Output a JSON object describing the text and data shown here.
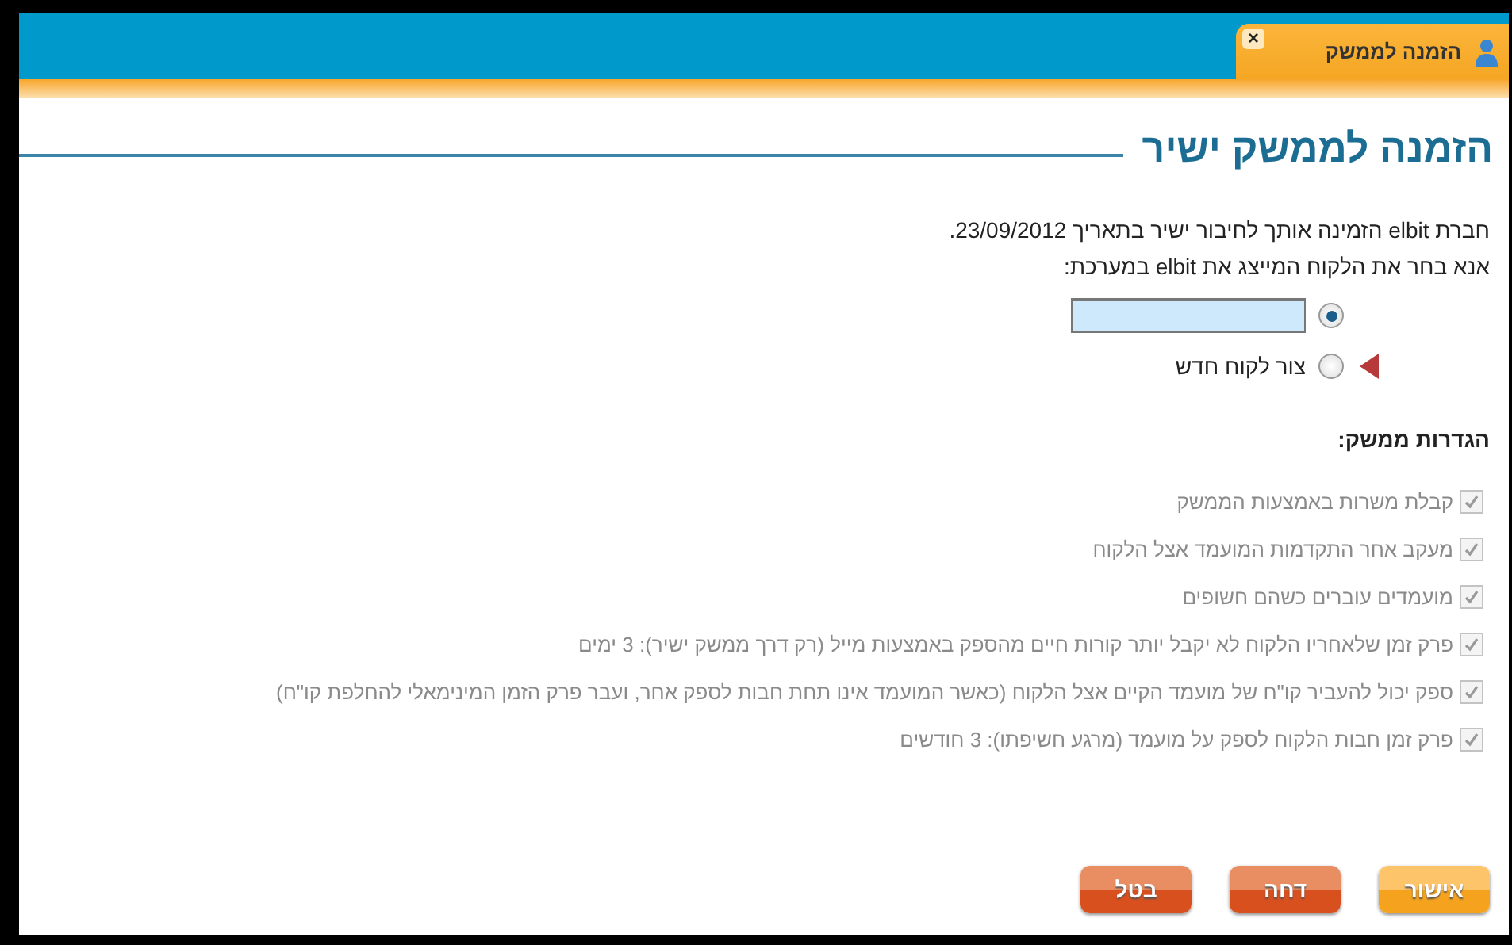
{
  "tab": {
    "title": "הזמנה לממשק",
    "close": "×"
  },
  "heading": "הזמנה לממשק ישיר",
  "intro": [
    "חברת elbit הזמינה אותך לחיבור ישיר בתאריך 23/09/2012.",
    "אנא בחר את הלקוח המייצג את elbit במערכת:"
  ],
  "options": [
    {
      "kind": "field",
      "selected": true
    },
    {
      "kind": "label",
      "label": "צור לקוח חדש",
      "selected": false
    }
  ],
  "settings_title": "הגדרות ממשק:",
  "settings": [
    {
      "label": "קבלת משרות באמצעות הממשק",
      "checked": true,
      "disabled": true
    },
    {
      "label": "מעקב אחר התקדמות המועמד אצל הלקוח",
      "checked": true,
      "disabled": true
    },
    {
      "label": "מועמדים עוברים כשהם חשופים",
      "checked": true,
      "disabled": true
    },
    {
      "label": "פרק זמן שלאחריו הלקוח לא יקבל יותר קורות חיים מהספק באמצעות מייל (רק דרך ממשק ישיר): 3 ימים",
      "checked": true,
      "disabled": true
    },
    {
      "label": "ספק יכול להעביר קו\"ח של מועמד הקיים אצל הלקוח (כאשר המועמד אינו תחת חבות לספק אחר, ועבר פרק הזמן המינימאלי להחלפת קו\"ח)",
      "checked": true,
      "disabled": true
    },
    {
      "label": "פרק זמן חבות הלקוח לספק על מועמד (מרגע חשיפתו): 3 חודשים",
      "checked": true,
      "disabled": true
    }
  ],
  "buttons": [
    {
      "label": "אישור",
      "kind": "primary"
    },
    {
      "label": "דחה",
      "kind": "danger"
    },
    {
      "label": "בטל",
      "kind": "danger"
    }
  ]
}
